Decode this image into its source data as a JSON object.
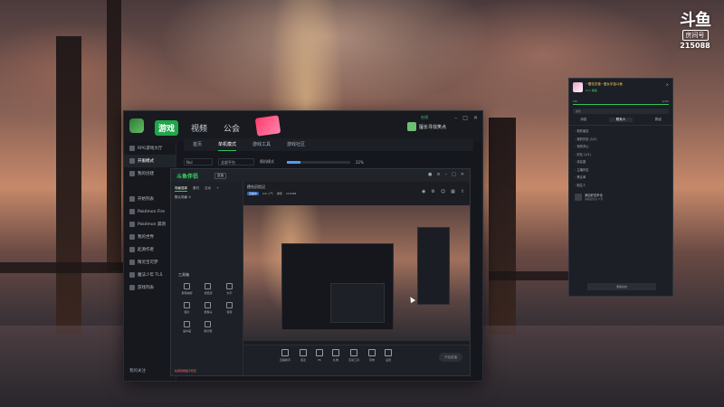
{
  "watermark": {
    "logo": "斗鱼",
    "sub": "房间号",
    "room_id": "215088"
  },
  "launcher": {
    "nav": [
      "游戏",
      "视频",
      "公会",
      "商城"
    ],
    "active_nav": "游戏",
    "user": "擅长寻找笑点",
    "status": "在线",
    "sidebar": {
      "items": [
        "RPG游戏大厅",
        "开服模式",
        "我的创建"
      ],
      "games_title": "",
      "games": [
        "开始列表",
        "Pokémon Fire",
        "Pokémon 漏洞",
        "我的世界",
        "起源作者",
        "精灵宝可梦",
        "魔法少年 TLS",
        "游戏列表"
      ],
      "bottom": "我的关注"
    },
    "tabs": [
      "首页",
      "单机模式",
      "游戏工具",
      "游戏社区"
    ],
    "active_tab": "单机模式",
    "filters": {
      "sort": "Nul",
      "platform": "全部平台",
      "progress_label": "随机模式",
      "progress_pct": "22%"
    },
    "progress": 0.22
  },
  "client": {
    "logo": "斗鱼伴侣",
    "tag": "直播",
    "left_tabs": [
      "场景选择",
      "素材",
      "互动"
    ],
    "scene": "默认场景 ①",
    "tools_title": "工具箱",
    "tools": [
      "屏幕捕捉",
      "视频源",
      "文字",
      "图片",
      "摄像头",
      "音频",
      "画中画",
      "聊天框"
    ],
    "footer_warn": "检测到网络不稳定",
    "room_title": "德先历险记",
    "room_tag": "直播",
    "room_meta": [
      "直播中",
      "0/0 人气",
      "弹幕",
      "215088"
    ],
    "bottom_items": [
      "直播助手",
      "连麦",
      "PK",
      "礼物",
      "互动工具",
      "音效",
      "设置"
    ],
    "start_button": "开始直播"
  },
  "chat": {
    "name": "~樱花花卷~爱女宇宙斗鱼",
    "level": "LV.1 等级",
    "xp_left": "159",
    "xp_right": "1/170",
    "search_placeholder": "搜索",
    "tabs": [
      "消息",
      "联系人",
      "群组"
    ],
    "active_tab": "联系人",
    "groups": [
      "新的朋友",
      "我的好友 (1/2)",
      "特别关心",
      "好友 (1/1)",
      "亲友团",
      "主播好友",
      "黑名单",
      "陌生人"
    ],
    "request_title": "添加好友申请",
    "request_sub": "请验证信息 3 条",
    "bottom_button": "添加好友"
  }
}
